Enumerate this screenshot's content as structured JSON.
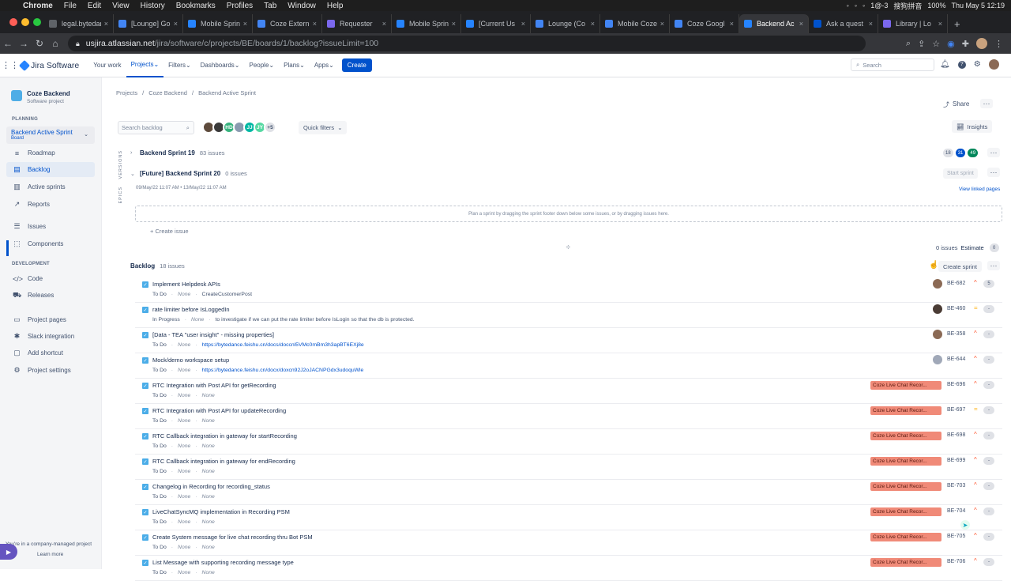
{
  "mac": {
    "menu": [
      "Chrome",
      "File",
      "Edit",
      "View",
      "History",
      "Bookmarks",
      "Profiles",
      "Tab",
      "Window",
      "Help"
    ],
    "status": [
      "1@-3",
      "搜狗拼音",
      "100%",
      "Thu May 5  12:19"
    ]
  },
  "browser": {
    "tabs": [
      {
        "title": "legal.bytedance",
        "color": "#5f6368"
      },
      {
        "title": "[Lounge] Go",
        "color": "#4285f4"
      },
      {
        "title": "Mobile Sprint",
        "color": "#2684ff"
      },
      {
        "title": "Coze Extern",
        "color": "#4285f4"
      },
      {
        "title": "Requester",
        "color": "#7b68ee"
      },
      {
        "title": "Mobile Sprint",
        "color": "#2684ff"
      },
      {
        "title": "[Current Us",
        "color": "#2684ff"
      },
      {
        "title": "Lounge (Co",
        "color": "#4285f4"
      },
      {
        "title": "Mobile Coze",
        "color": "#4285f4"
      },
      {
        "title": "Coze Googl",
        "color": "#4285f4"
      },
      {
        "title": "Backend Ac",
        "color": "#2684ff",
        "active": true
      },
      {
        "title": "Ask a quest",
        "color": "#0052cc"
      },
      {
        "title": "Library | Lo",
        "color": "#7b68ee"
      }
    ],
    "url_host": "usjira.atlassian.net",
    "url_path": "/jira/software/c/projects/BE/boards/1/backlog?issueLimit=100"
  },
  "topnav": {
    "product": "Jira Software",
    "items": [
      "Your work",
      "Projects",
      "Filters",
      "Dashboards",
      "People",
      "Plans",
      "Apps"
    ],
    "create": "Create",
    "search_placeholder": "Search"
  },
  "sidebar": {
    "project_name": "Coze Backend",
    "project_type": "Software project",
    "planning_label": "PLANNING",
    "board_name": "Backend Active Sprint",
    "board_sub": "Board",
    "planning_items": [
      "Roadmap",
      "Backlog",
      "Active sprints",
      "Reports"
    ],
    "other_items": [
      "Issues",
      "Components"
    ],
    "development_label": "DEVELOPMENT",
    "dev_items": [
      "Code",
      "Releases"
    ],
    "bottom_items": [
      "Project pages",
      "Slack integration",
      "Add shortcut",
      "Project settings"
    ],
    "company_managed": "You're in a company-managed project",
    "learn_more": "Learn more"
  },
  "main": {
    "breadcrumb": [
      "Projects",
      "Coze Backend",
      "Backend Active Sprint"
    ],
    "share": "Share",
    "search_placeholder": "Search backlog",
    "avatars": [
      {
        "label": "",
        "color": "#5e4b3c"
      },
      {
        "label": "",
        "color": "#3a3a3a"
      },
      {
        "label": "HD",
        "color": "#36b37e"
      },
      {
        "label": "",
        "color": "#8a9bb0"
      },
      {
        "label": "JJ",
        "color": "#00b8a3"
      },
      {
        "label": "JY",
        "color": "#57d9a3"
      },
      {
        "label": "+5",
        "color": "#dfe1e6"
      }
    ],
    "quick_filters": "Quick filters",
    "insights": "Insights",
    "versions_label": "VERSIONS",
    "epics_label": "EPICS",
    "sprint19": {
      "name": "Backend Sprint 19",
      "count": "83 issues",
      "pills": [
        "18",
        "31",
        "49"
      ]
    },
    "sprint20": {
      "name": "[Future] Backend Sprint 20",
      "count": "0 issues",
      "dates": "09/May/22 11:07 AM  •  13/May/22 11:07 AM",
      "start": "Start sprint"
    },
    "view_linked": "View linked pages",
    "dropzone": "Plan a sprint by dragging the sprint footer down below some issues, or by dragging issues here.",
    "create_issue": "+ Create issue",
    "estimate": {
      "issues": "0 issues",
      "label": "Estimate",
      "value": "0"
    },
    "backlog": {
      "name": "Backlog",
      "count": "18 issues",
      "create_sprint": "Create sprint"
    },
    "issues": [
      {
        "summary": "Implement Helpdesk APIs",
        "status": "To Do",
        "none": "None",
        "extra": "CreateCustomerPost",
        "link": false,
        "epic": "",
        "key": "BE-682",
        "pri": "^",
        "pricolor": "#ff5630",
        "pts": "5",
        "avatar": "#8b6a55"
      },
      {
        "summary": "rate limiter before IsLoggedIn",
        "status": "In Progress",
        "none": "None",
        "extra": "to investigate if we can put the rate limiter before IsLogin so that the db is protected.",
        "link": false,
        "epic": "",
        "key": "BE-460",
        "pri": "=",
        "pricolor": "#ffab00",
        "pts": "-",
        "avatar": "#4a3c35"
      },
      {
        "summary": "[Data - TEA \"user insight\" - missing properties]",
        "status": "To Do",
        "none": "None",
        "extra": "https://bytedance.feishu.cn/docs/doccnl5VMc0mBm3h3apBT6EXj8e",
        "link": true,
        "epic": "",
        "key": "BE-358",
        "pri": "^",
        "pricolor": "#ff5630",
        "pts": "-",
        "avatar": "#8b6a55"
      },
      {
        "summary": "Mock/demo workspace setup",
        "status": "To Do",
        "none": "None",
        "extra": "https://bytedance.feishu.cn/docx/doxcn92J2oJACNPGdx3udoquWle",
        "link": true,
        "epic": "",
        "key": "BE-644",
        "pri": "^",
        "pricolor": "#ff5630",
        "pts": "-",
        "avatar": "#a0a8b8"
      },
      {
        "summary": "RTC Integration with Post API for getRecording",
        "status": "To Do",
        "none": "None",
        "extra": "None",
        "link": false,
        "epic": "Coze Live Chat Recor...",
        "key": "BE-696",
        "pri": "^",
        "pricolor": "#ff5630",
        "pts": "-",
        "avatar": ""
      },
      {
        "summary": "RTC Integration with Post API for updateRecording",
        "status": "To Do",
        "none": "None",
        "extra": "None",
        "link": false,
        "epic": "Coze Live Chat Recor...",
        "key": "BE-697",
        "pri": "=",
        "pricolor": "#ffab00",
        "pts": "-",
        "avatar": ""
      },
      {
        "summary": "RTC Callback integration in gateway for startRecording",
        "status": "To Do",
        "none": "None",
        "extra": "None",
        "link": false,
        "epic": "Coze Live Chat Recor...",
        "key": "BE-698",
        "pri": "^",
        "pricolor": "#ff5630",
        "pts": "-",
        "avatar": ""
      },
      {
        "summary": "RTC Callback integration in gateway for endRecording",
        "status": "To Do",
        "none": "None",
        "extra": "None",
        "link": false,
        "epic": "Coze Live Chat Recor...",
        "key": "BE-699",
        "pri": "^",
        "pricolor": "#ff5630",
        "pts": "-",
        "avatar": ""
      },
      {
        "summary": "Changelog in Recording for recording_status",
        "status": "To Do",
        "none": "None",
        "extra": "None",
        "link": false,
        "epic": "Coze Live Chat Recor...",
        "key": "BE-703",
        "pri": "^",
        "pricolor": "#ff5630",
        "pts": "-",
        "avatar": ""
      },
      {
        "summary": "LiveChatSyncMQ implementation in Recording PSM",
        "status": "To Do",
        "none": "None",
        "extra": "None",
        "link": false,
        "epic": "Coze Live Chat Recor...",
        "key": "BE-704",
        "pri": "^",
        "pricolor": "#ff5630",
        "pts": "-",
        "avatar": ""
      },
      {
        "summary": "Create System message for live chat recording thru Bot PSM",
        "status": "To Do",
        "none": "None",
        "extra": "None",
        "link": false,
        "epic": "Coze Live Chat Recor...",
        "key": "BE-705",
        "pri": "^",
        "pricolor": "#ff5630",
        "pts": "-",
        "avatar": ""
      },
      {
        "summary": "List Message with supporting recording message type",
        "status": "To Do",
        "none": "None",
        "extra": "None",
        "link": false,
        "epic": "Coze Live Chat Recor...",
        "key": "BE-706",
        "pri": "^",
        "pricolor": "#ff5630",
        "pts": "-",
        "avatar": ""
      }
    ]
  }
}
